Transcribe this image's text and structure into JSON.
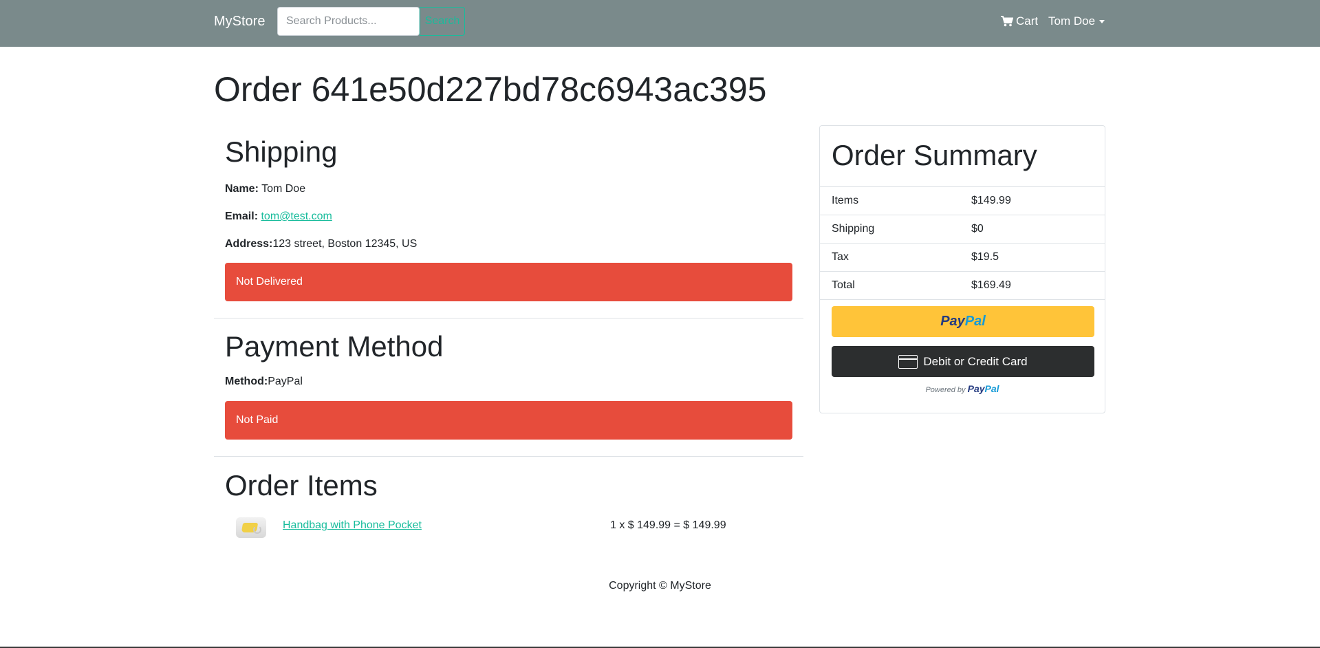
{
  "navbar": {
    "brand": "MyStore",
    "search_placeholder": "Search Products...",
    "search_button": "Search",
    "cart_label": "Cart",
    "user_label": "Tom Doe"
  },
  "order": {
    "title": "Order 641e50d227bd78c6943ac395"
  },
  "shipping": {
    "heading": "Shipping",
    "name_label": "Name:",
    "name_value": "Tom Doe",
    "email_label": "Email:",
    "email_value": "tom@test.com",
    "address_label": "Address:",
    "address_value": "123 street, Boston 12345, US",
    "status": "Not Delivered"
  },
  "payment": {
    "heading": "Payment Method",
    "method_label": "Method:",
    "method_value": "PayPal",
    "status": "Not Paid"
  },
  "order_items": {
    "heading": "Order Items",
    "items": [
      {
        "name": "Handbag with Phone Pocket",
        "calc": "1 x $ 149.99 = $ 149.99"
      }
    ]
  },
  "summary": {
    "heading": "Order Summary",
    "rows": [
      {
        "label": "Items",
        "value": "$149.99"
      },
      {
        "label": "Shipping",
        "value": "$0"
      },
      {
        "label": "Tax",
        "value": "$19.5"
      },
      {
        "label": "Total",
        "value": "$169.49"
      }
    ],
    "paypal_pay": "Pay",
    "paypal_pal": "Pal",
    "card_button": "Debit or Credit Card",
    "powered_by": "Powered by"
  },
  "footer": {
    "copyright": "Copyright © MyStore"
  },
  "colors": {
    "navbar": "#7a8a8b",
    "accent": "#18bc9c",
    "danger": "#e74c3c",
    "paypal_yellow": "#ffc439",
    "card_dark": "#2c2e2f"
  }
}
